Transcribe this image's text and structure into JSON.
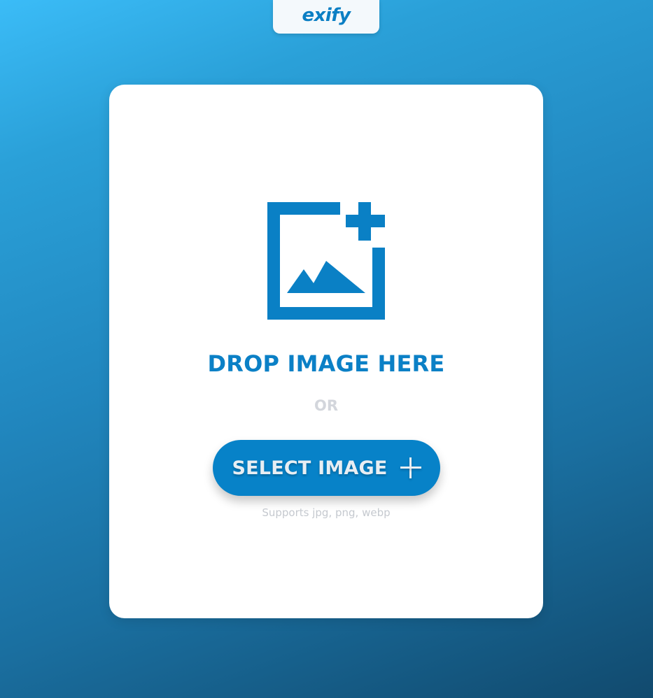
{
  "header": {
    "logo_text": "exify"
  },
  "upload": {
    "drop_title": "DROP IMAGE HERE",
    "or_text": "OR",
    "select_button_label": "SELECT IMAGE",
    "supports_text": "Supports jpg, png, webp",
    "icon": "add-image-icon",
    "button_icon": "plus-icon"
  },
  "colors": {
    "accent": "#0782c8",
    "title": "#0b80c6",
    "background_start": "#3bbcf7",
    "background_end": "#114a6e",
    "card": "#ffffff",
    "muted_text": "#c5c9cf"
  }
}
